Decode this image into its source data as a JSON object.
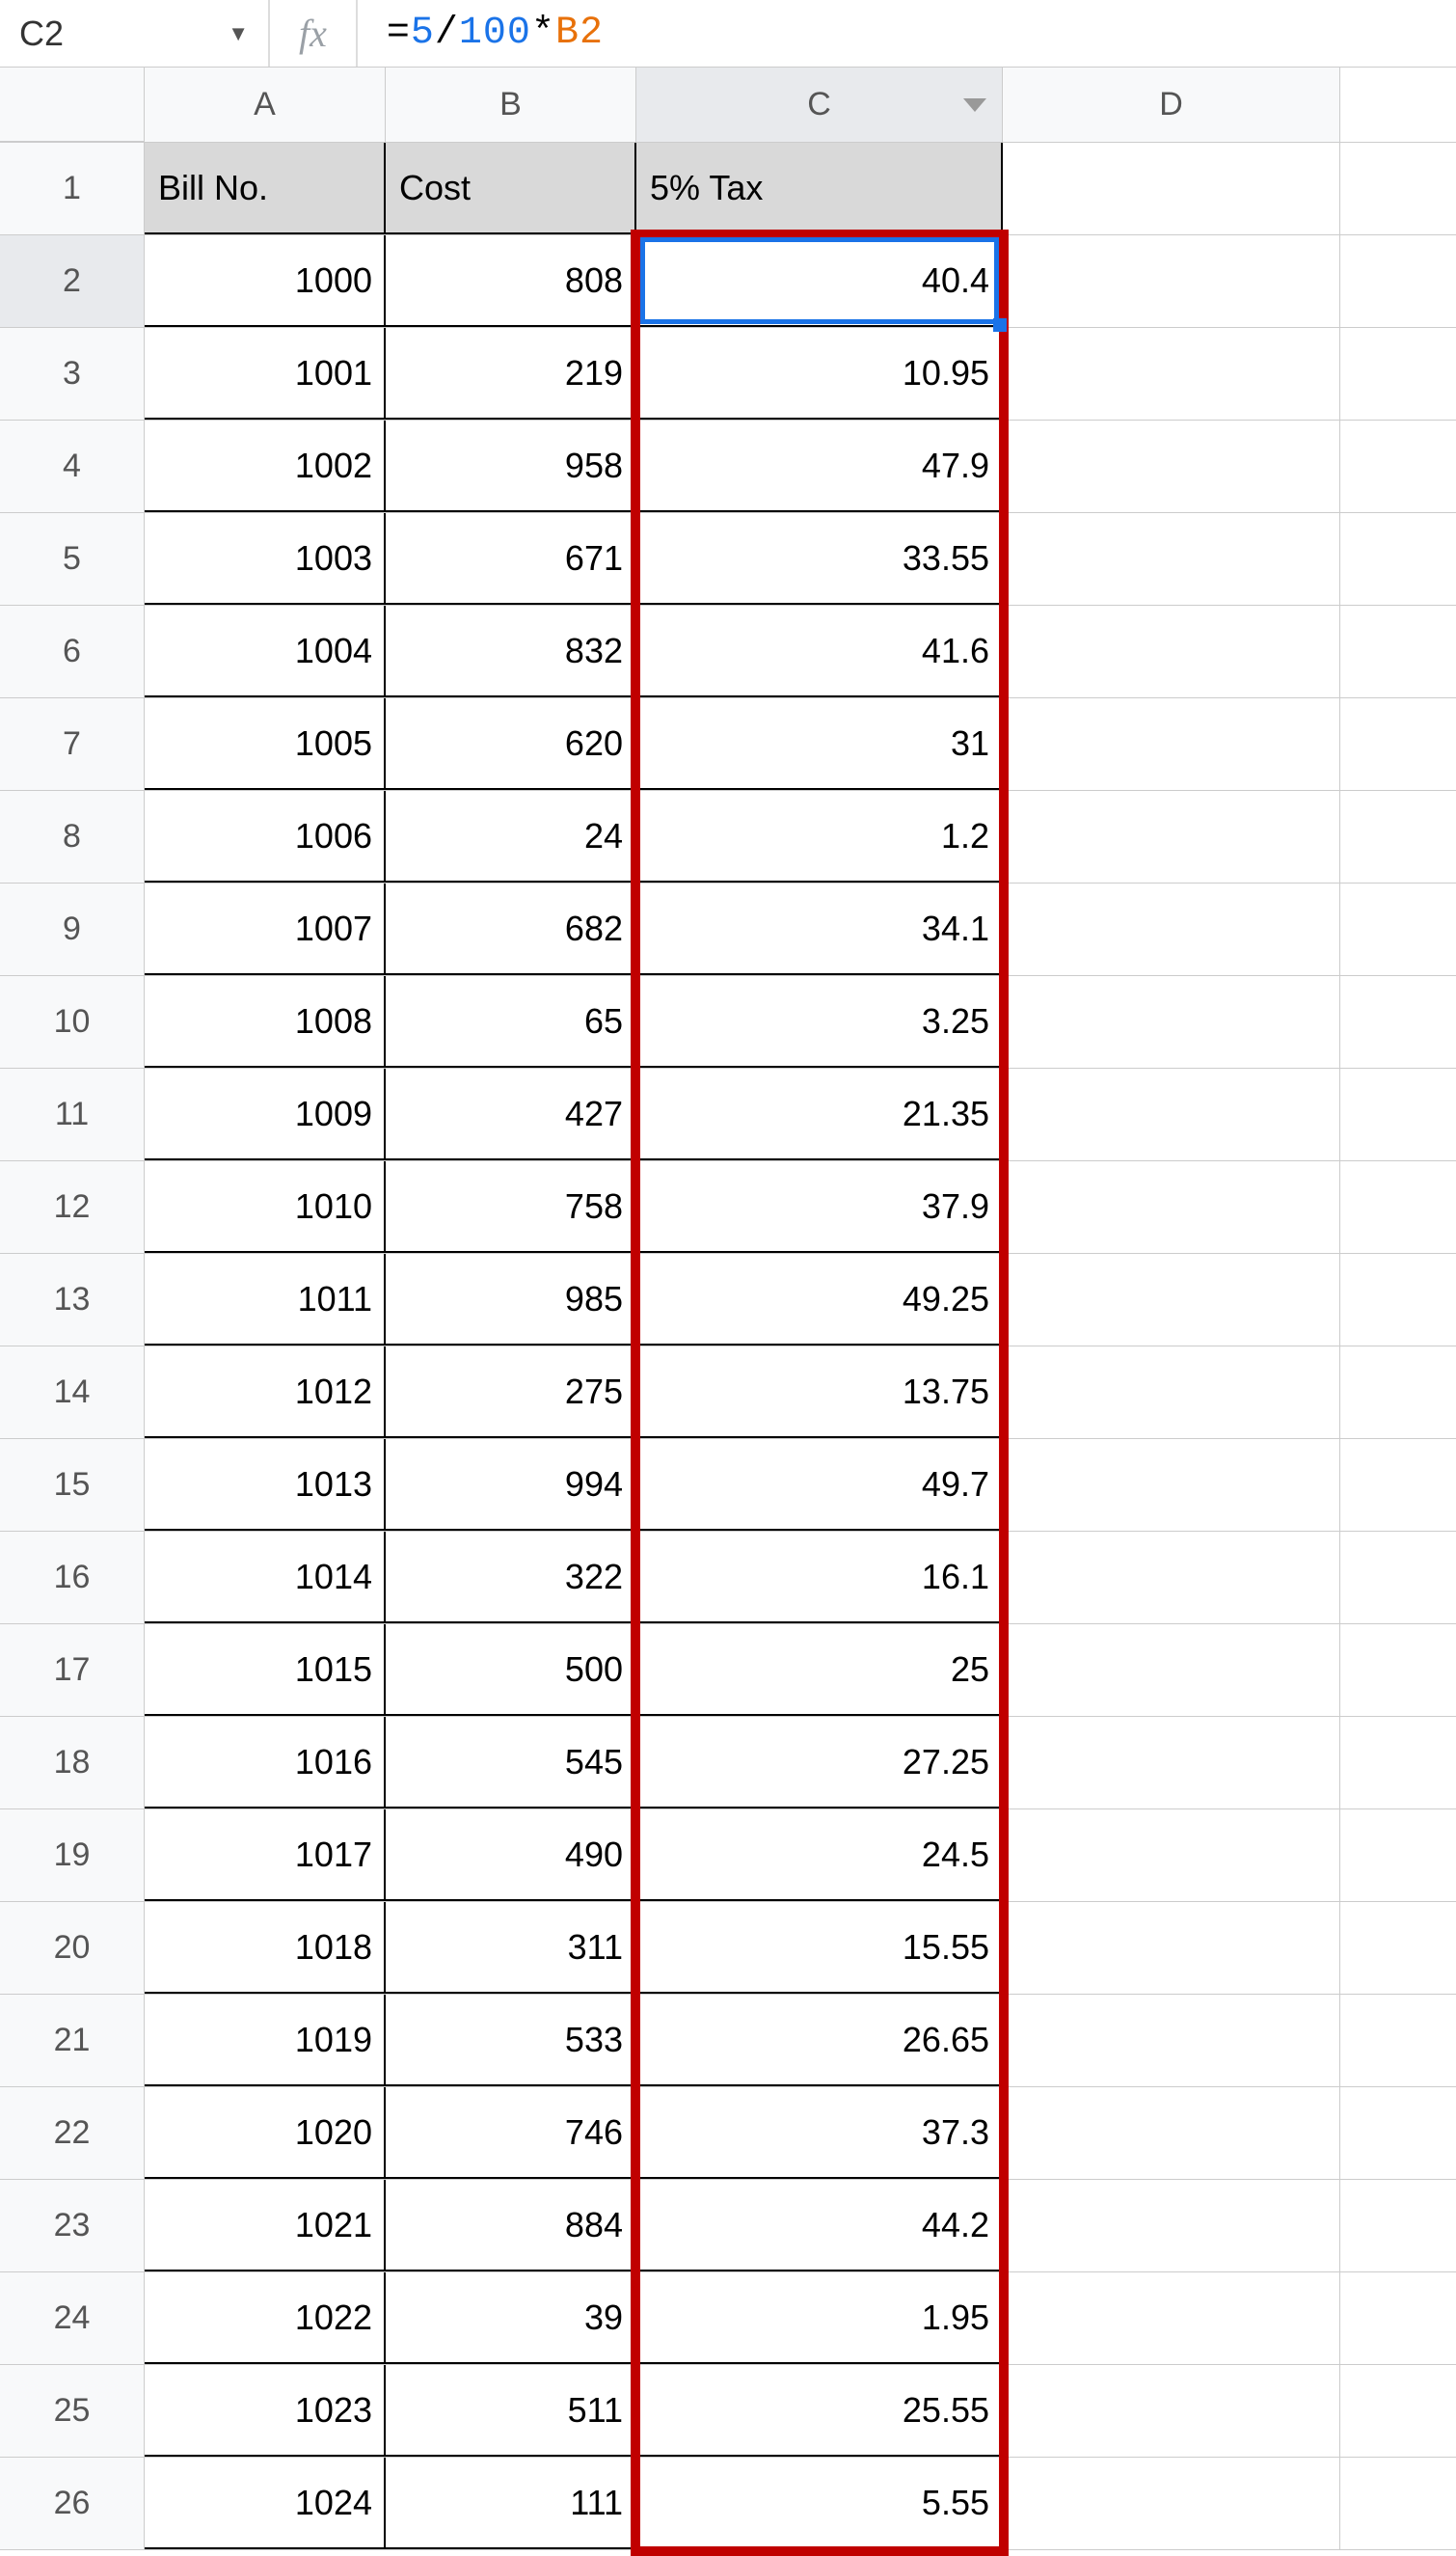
{
  "name_box": "C2",
  "fx_label": "fx",
  "formula": {
    "eq": "=",
    "n1": "5",
    "op1": "/",
    "n2": "100",
    "op2": "*",
    "ref": "B2"
  },
  "col_headers": [
    "A",
    "B",
    "C",
    "D"
  ],
  "title_row": {
    "A": "Bill No.",
    "B": "Cost",
    "C": "5% Tax"
  },
  "rows": [
    {
      "n": "1"
    },
    {
      "n": "2",
      "A": "1000",
      "B": "808",
      "C": "40.4"
    },
    {
      "n": "3",
      "A": "1001",
      "B": "219",
      "C": "10.95"
    },
    {
      "n": "4",
      "A": "1002",
      "B": "958",
      "C": "47.9"
    },
    {
      "n": "5",
      "A": "1003",
      "B": "671",
      "C": "33.55"
    },
    {
      "n": "6",
      "A": "1004",
      "B": "832",
      "C": "41.6"
    },
    {
      "n": "7",
      "A": "1005",
      "B": "620",
      "C": "31"
    },
    {
      "n": "8",
      "A": "1006",
      "B": "24",
      "C": "1.2"
    },
    {
      "n": "9",
      "A": "1007",
      "B": "682",
      "C": "34.1"
    },
    {
      "n": "10",
      "A": "1008",
      "B": "65",
      "C": "3.25"
    },
    {
      "n": "11",
      "A": "1009",
      "B": "427",
      "C": "21.35"
    },
    {
      "n": "12",
      "A": "1010",
      "B": "758",
      "C": "37.9"
    },
    {
      "n": "13",
      "A": "1011",
      "B": "985",
      "C": "49.25"
    },
    {
      "n": "14",
      "A": "1012",
      "B": "275",
      "C": "13.75"
    },
    {
      "n": "15",
      "A": "1013",
      "B": "994",
      "C": "49.7"
    },
    {
      "n": "16",
      "A": "1014",
      "B": "322",
      "C": "16.1"
    },
    {
      "n": "17",
      "A": "1015",
      "B": "500",
      "C": "25"
    },
    {
      "n": "18",
      "A": "1016",
      "B": "545",
      "C": "27.25"
    },
    {
      "n": "19",
      "A": "1017",
      "B": "490",
      "C": "24.5"
    },
    {
      "n": "20",
      "A": "1018",
      "B": "311",
      "C": "15.55"
    },
    {
      "n": "21",
      "A": "1019",
      "B": "533",
      "C": "26.65"
    },
    {
      "n": "22",
      "A": "1020",
      "B": "746",
      "C": "37.3"
    },
    {
      "n": "23",
      "A": "1021",
      "B": "884",
      "C": "44.2"
    },
    {
      "n": "24",
      "A": "1022",
      "B": "39",
      "C": "1.95"
    },
    {
      "n": "25",
      "A": "1023",
      "B": "511",
      "C": "25.55"
    },
    {
      "n": "26",
      "A": "1024",
      "B": "111",
      "C": "5.55"
    }
  ]
}
